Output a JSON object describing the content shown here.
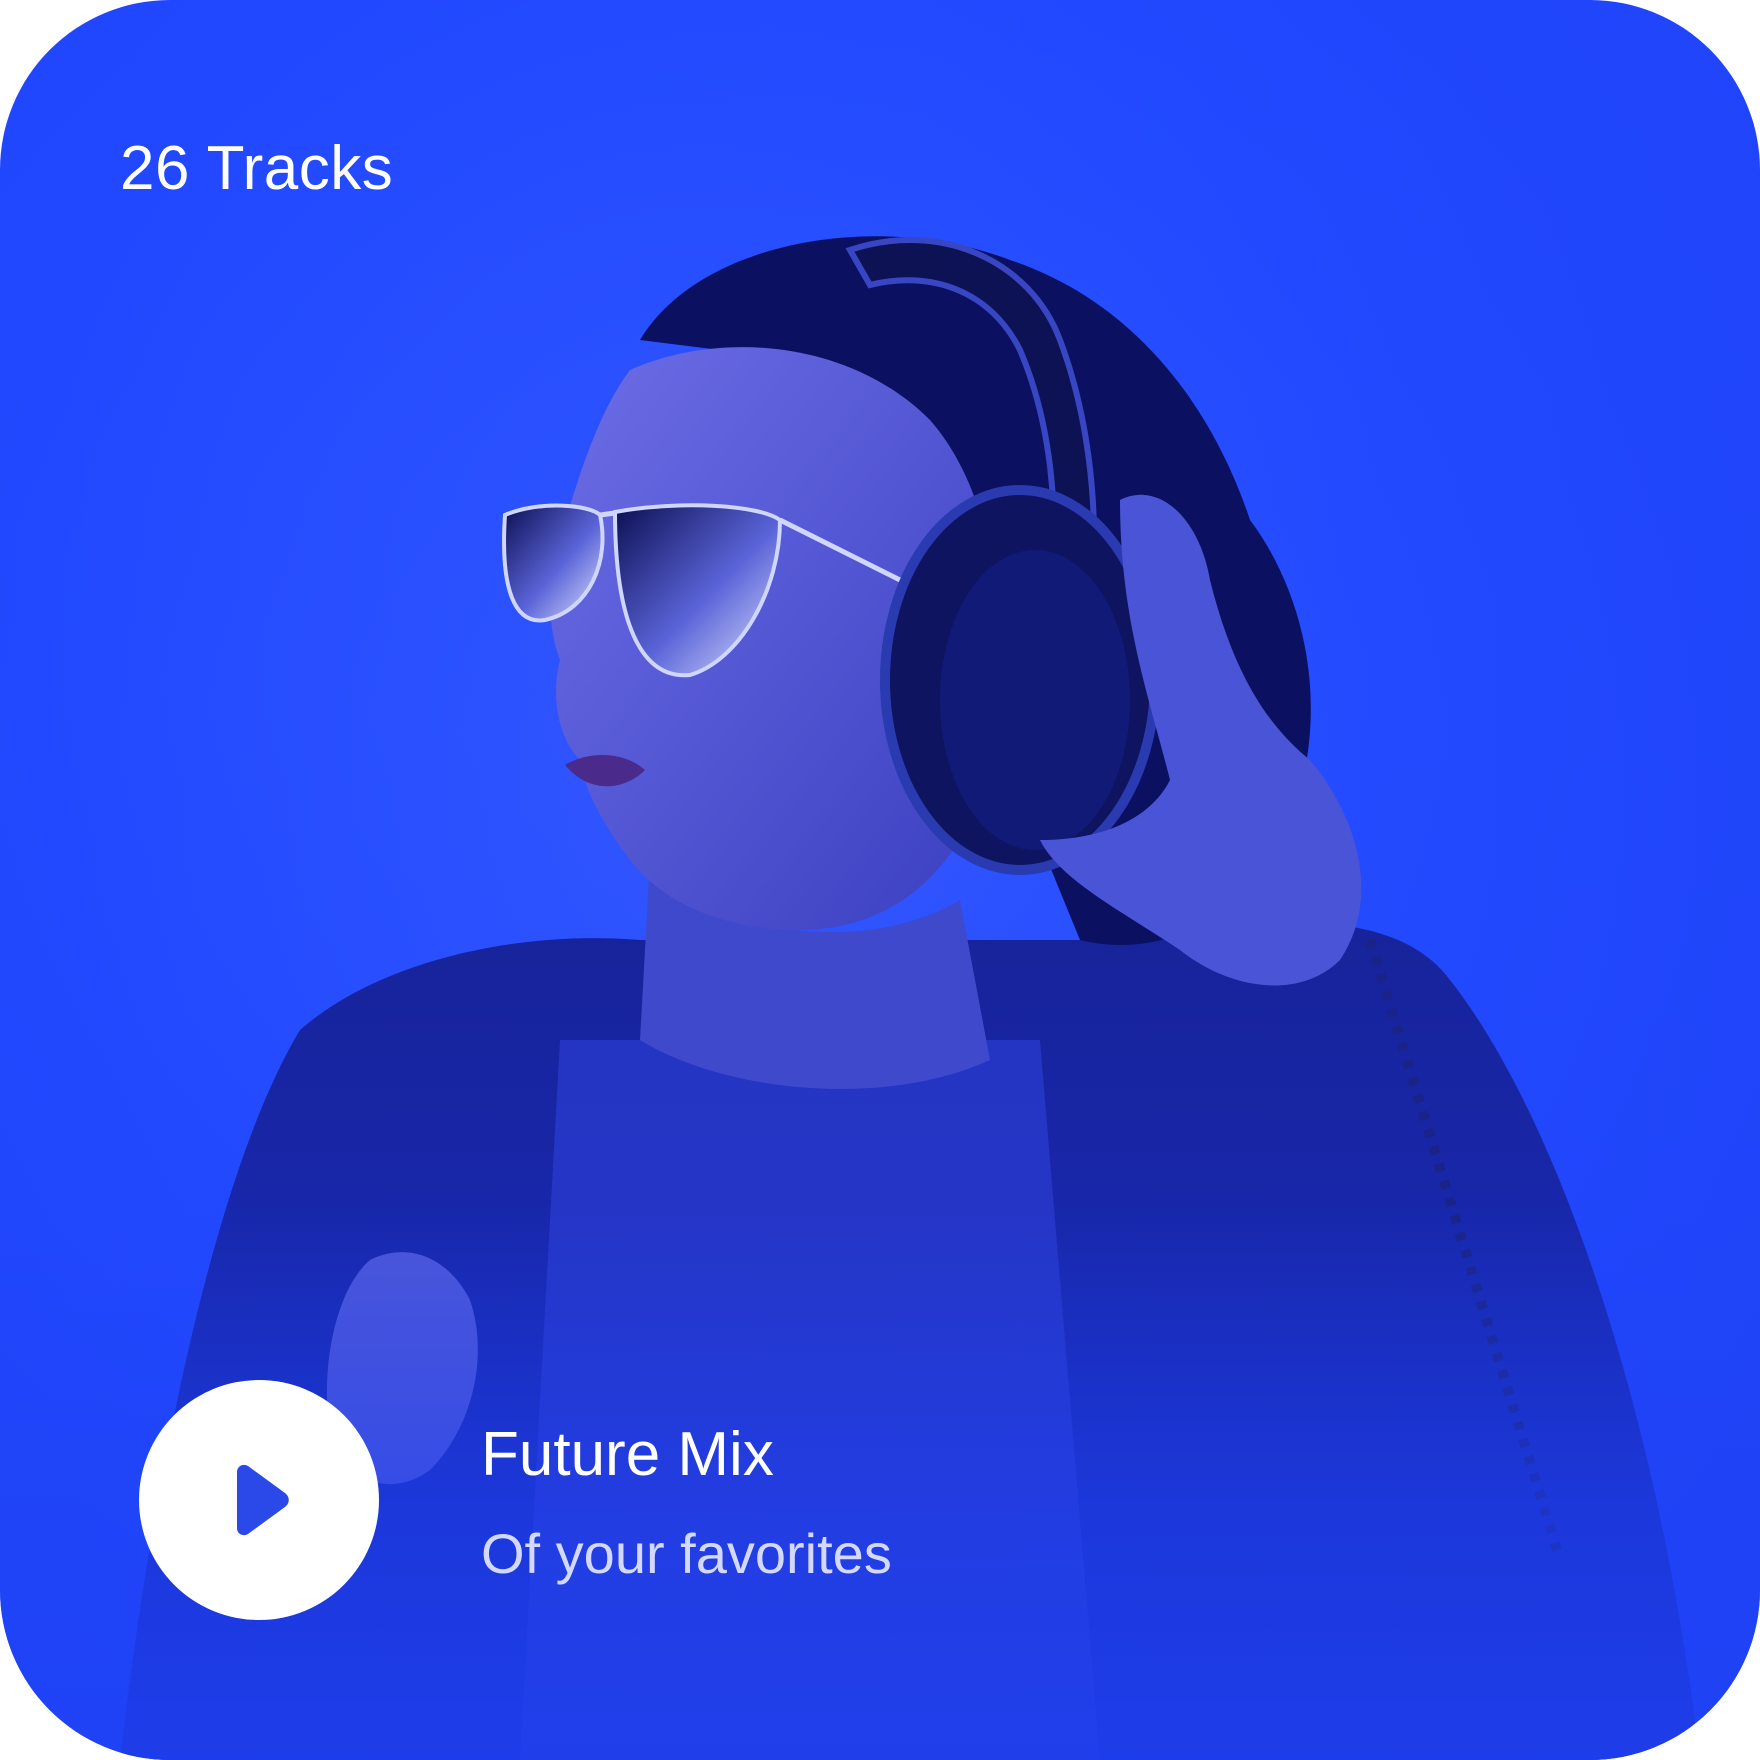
{
  "card": {
    "track_count": "26 Tracks",
    "title": "Future Mix",
    "subtitle": "Of your favorites",
    "play_icon": "play-icon",
    "colors": {
      "background": "#2148ff",
      "accent": "#2a49e8",
      "text": "#ffffff",
      "subtitle_text": "#d2d8ff"
    }
  }
}
